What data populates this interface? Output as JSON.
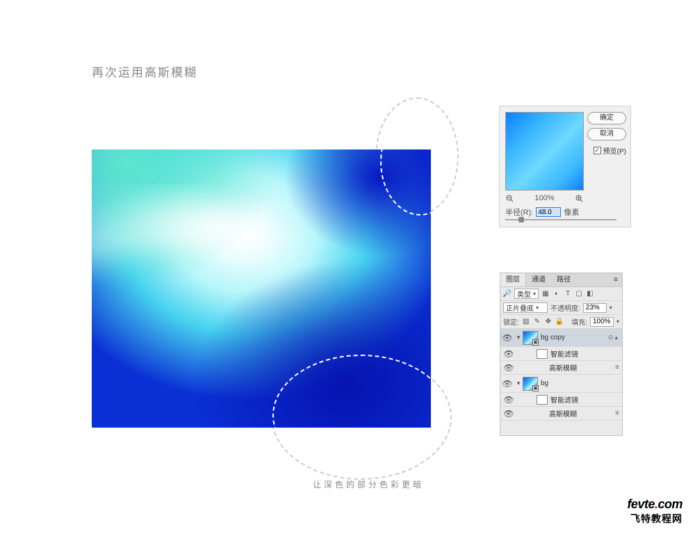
{
  "title": "再次运用高斯模糊",
  "caption": "让深色的部分色彩更暗",
  "dialog": {
    "ok": "确定",
    "cancel": "取消",
    "preview_label": "预览(P)",
    "zoom_pct": "100%",
    "radius_label": "半径(R):",
    "radius_value": "48.0",
    "radius_unit": "像素"
  },
  "layers_panel": {
    "tabs": {
      "layers": "图层",
      "channels": "通道",
      "paths": "路径"
    },
    "filter_label": "类型",
    "blend_mode": "正片叠底",
    "opacity_label": "不透明度:",
    "opacity_value": "23%",
    "lock_label": "锁定:",
    "fill_label": "填充:",
    "fill_value": "100%",
    "layers": [
      {
        "name": "bg copy",
        "smart": true,
        "sub": [
          {
            "label": "智能滤镜",
            "type": "header"
          },
          {
            "label": "高斯模糊",
            "type": "filter"
          }
        ]
      },
      {
        "name": "bg",
        "smart": true,
        "sub": [
          {
            "label": "智能滤镜",
            "type": "header"
          },
          {
            "label": "高斯模糊",
            "type": "filter"
          }
        ]
      }
    ]
  },
  "watermark": {
    "site": "fevte",
    "dot": ".",
    "tld": "com",
    "cn": "飞特教程网"
  }
}
